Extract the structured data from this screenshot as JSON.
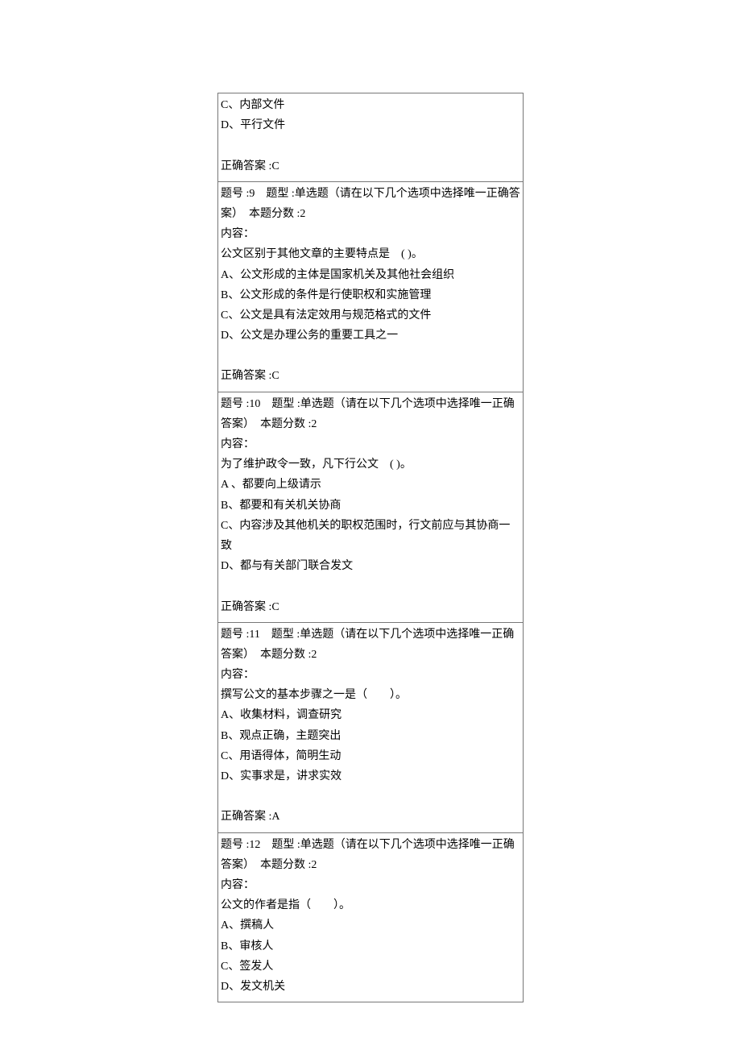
{
  "q8_tail": {
    "optC": "C、内部文件",
    "optD": "D、平行文件",
    "answer": "正确答案 :C"
  },
  "q9": {
    "header": "题号 :9　题型 :单选题（请在以下几个选项中选择唯一正确答案）　本题分数 :2",
    "content_label": "内容：",
    "stem": "公文区别于其他文章的主要特点是　( )。",
    "optA": "A、公文形成的主体是国家机关及其他社会组织",
    "optB": "B、公文形成的条件是行使职权和实施管理",
    "optC": "C、公文是具有法定效用与规范格式的文件",
    "optD": "D、公文是办理公务的重要工具之一",
    "answer": "正确答案 :C"
  },
  "q10": {
    "header": "题号 :10　题型 :单选题（请在以下几个选项中选择唯一正确答案）　本题分数 :2",
    "content_label": "内容：",
    "stem": "为了维护政令一致，凡下行公文　( )。",
    "optA": "A 、都要向上级请示",
    "optB": "B、都要和有关机关协商",
    "optC": "C、内容涉及其他机关的职权范围时，行文前应与其协商一致",
    "optD": "D、都与有关部门联合发文",
    "answer": "正确答案 :C"
  },
  "q11": {
    "header": "题号 :11　题型 :单选题（请在以下几个选项中选择唯一正确答案）　本题分数 :2",
    "content_label": "内容：",
    "stem": "撰写公文的基本步骤之一是（　　）。",
    "optA": "A、收集材料，调查研究",
    "optB": "B、观点正确，主题突出",
    "optC": "C、用语得体，简明生动",
    "optD": "D、实事求是，讲求实效",
    "answer": "正确答案 :A"
  },
  "q12": {
    "header": "题号 :12　题型 :单选题（请在以下几个选项中选择唯一正确答案）　本题分数 :2",
    "content_label": "内容：",
    "stem": "公文的作者是指（　　）。",
    "optA": "A、撰稿人",
    "optB": "B、审核人",
    "optC": "C、签发人",
    "optD": "D、发文机关"
  }
}
